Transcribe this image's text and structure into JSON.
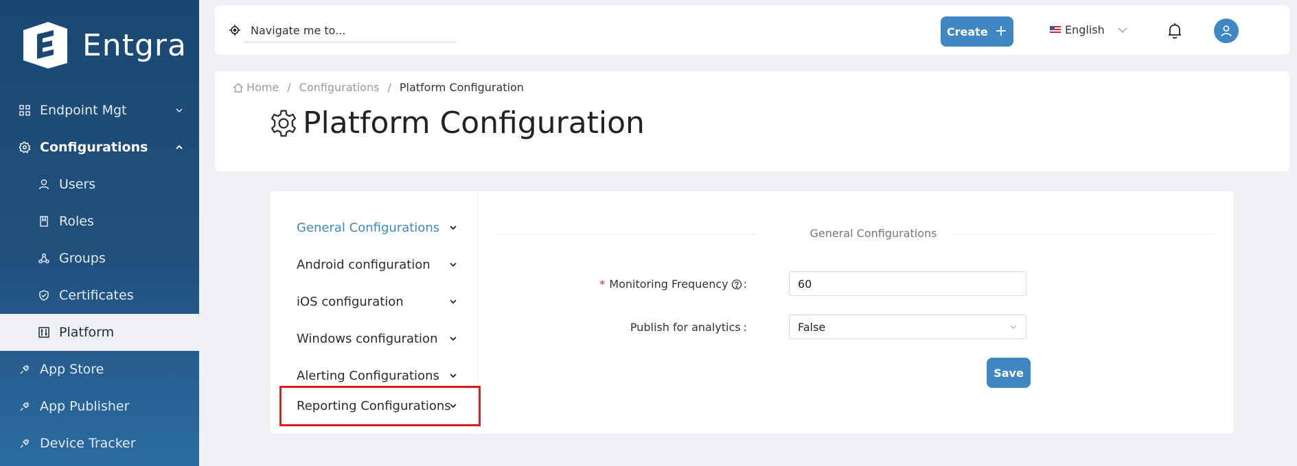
{
  "brand": {
    "name": "Entgra"
  },
  "sidebar": {
    "items": [
      {
        "label": "Endpoint Mgt"
      },
      {
        "label": "Configurations"
      },
      {
        "label": "Users"
      },
      {
        "label": "Roles"
      },
      {
        "label": "Groups"
      },
      {
        "label": "Certificates"
      },
      {
        "label": "Platform"
      },
      {
        "label": "App Store"
      },
      {
        "label": "App Publisher"
      },
      {
        "label": "Device Tracker"
      }
    ]
  },
  "topbar": {
    "search_placeholder": "Navigate me to...",
    "create_label": "Create",
    "language": "English"
  },
  "breadcrumb": {
    "home": "Home",
    "parent": "Configurations",
    "current": "Platform Configuration"
  },
  "page": {
    "title": "Platform Configuration"
  },
  "config_menu": {
    "items": [
      {
        "label": "General Configurations"
      },
      {
        "label": "Android configuration"
      },
      {
        "label": "iOS configuration"
      },
      {
        "label": "Windows configuration"
      },
      {
        "label": "Alerting Configurations"
      },
      {
        "label": "Reporting Configurations"
      }
    ]
  },
  "form": {
    "section_title": "General Configurations",
    "monitoring_label": "Monitoring Frequency",
    "monitoring_value": "60",
    "analytics_label": "Publish for analytics",
    "analytics_value": "False",
    "save_label": "Save"
  },
  "colors": {
    "accent": "#3f87c3",
    "sidebar": "#1b4872",
    "highlight": "#e01b24"
  }
}
